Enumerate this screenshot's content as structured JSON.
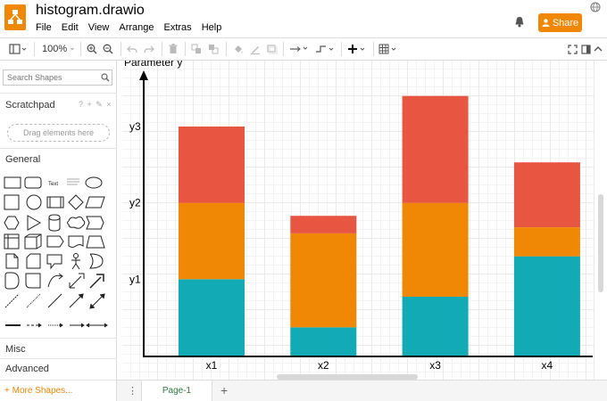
{
  "app": {
    "title": "histogram.drawio",
    "menu": [
      "File",
      "Edit",
      "View",
      "Arrange",
      "Extras",
      "Help"
    ],
    "share_label": "Share"
  },
  "toolbar": {
    "zoom": "100%"
  },
  "sidebar": {
    "search_placeholder": "Search Shapes",
    "scratchpad_label": "Scratchpad",
    "scratchpad_icons": "? + ✎ ×",
    "drag_hint": "Drag elements here",
    "general_label": "General",
    "text_shape_label": "Text",
    "misc_label": "Misc",
    "advanced_label": "Advanced",
    "more_shapes_label": "+ More Shapes..."
  },
  "pages": {
    "tabs": [
      "Page-1"
    ]
  },
  "colors": {
    "accent": "#f08705",
    "bottom": "#12aab5",
    "middle": "#f08705",
    "top": "#e85642"
  },
  "chart_data": {
    "type": "bar",
    "stacked": true,
    "ylabel": "Parameter y",
    "categories": [
      "x1",
      "x2",
      "x3",
      "x4"
    ],
    "y_ticks": [
      "y1",
      "y2",
      "y3"
    ],
    "ylim": [
      0,
      3.7
    ],
    "series": [
      {
        "values": [
          1.0,
          0.37,
          0.77,
          1.3
        ]
      },
      {
        "values": [
          1.0,
          1.23,
          1.23,
          0.38
        ]
      },
      {
        "values": [
          1.0,
          0.23,
          1.4,
          0.85
        ]
      }
    ]
  }
}
